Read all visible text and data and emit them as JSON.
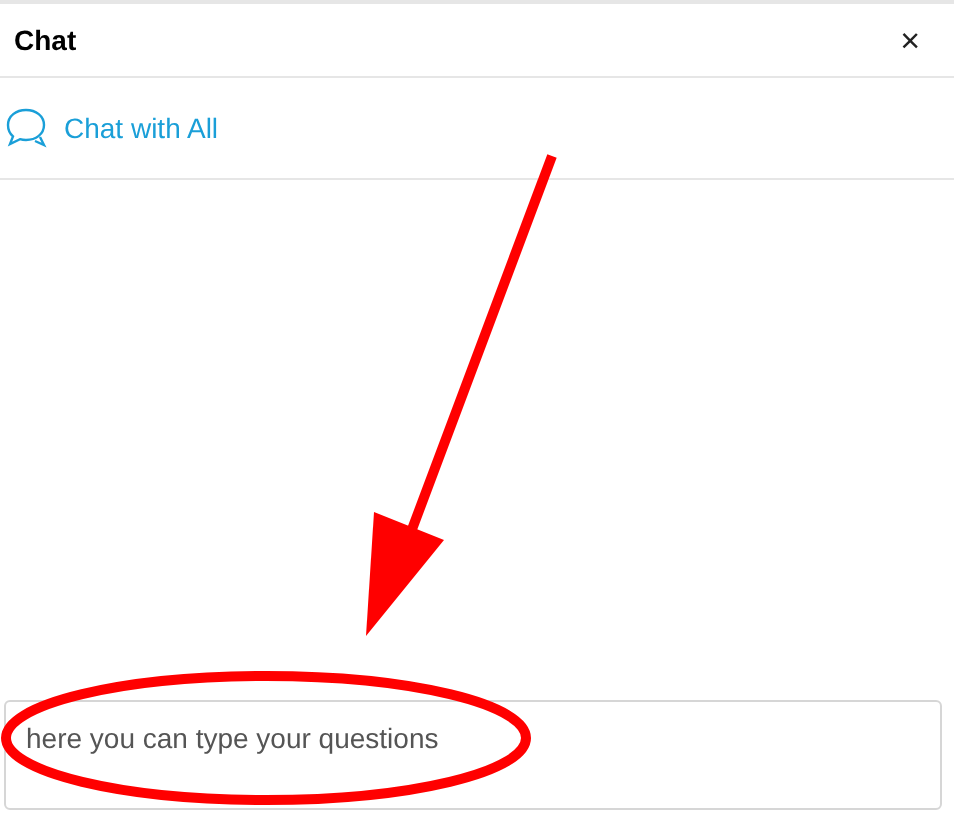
{
  "panel": {
    "title": "Chat",
    "close": "×"
  },
  "channels": [
    {
      "label": "Chat with All"
    }
  ],
  "message_field": {
    "value": "here you can type your questions"
  }
}
